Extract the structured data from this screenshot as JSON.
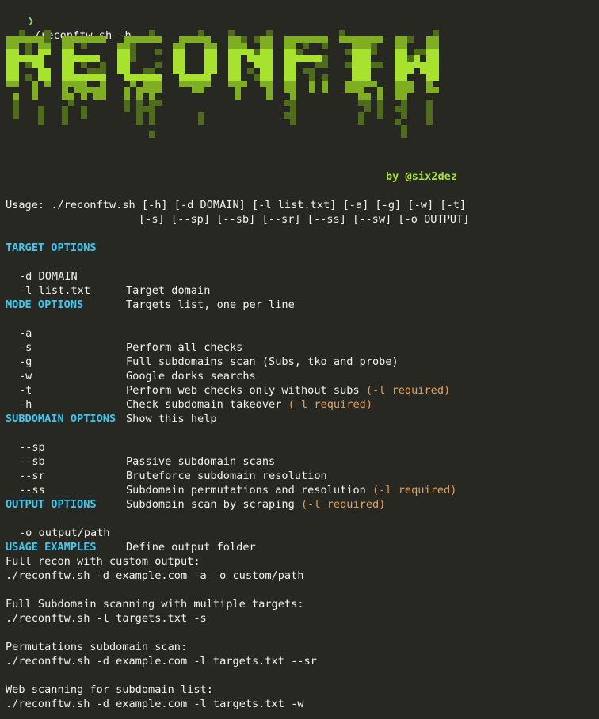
{
  "prompt": {
    "arrow": "❯",
    "command": "./reconftw.sh -h"
  },
  "banner": {
    "logo_text": "RECONFTW",
    "author": "by @six2dez",
    "colors": {
      "bright": "#a6e22e",
      "mid": "#7fae22",
      "dark": "#4f6b1c"
    }
  },
  "usage": {
    "line1": "Usage: ./reconftw.sh [-h] [-d DOMAIN] [-l list.txt] [-a] [-g] [-w] [-t]",
    "line2": "[-s] [--sp] [--sb] [--sr] [--ss] [--sw] [-o OUTPUT]"
  },
  "target_options": {
    "heading": "TARGET OPTIONS",
    "items": [
      {
        "flag": "-d DOMAIN",
        "desc": "Target domain",
        "note": ""
      },
      {
        "flag": "-l list.txt",
        "desc": "Targets list, one per line",
        "note": ""
      }
    ]
  },
  "mode_options": {
    "heading": "MODE OPTIONS",
    "items": [
      {
        "flag": "-a",
        "desc": "Perform all checks",
        "note": ""
      },
      {
        "flag": "-s",
        "desc": "Full subdomains scan (Subs, tko and probe)",
        "note": ""
      },
      {
        "flag": "-g",
        "desc": "Google dorks searchs",
        "note": ""
      },
      {
        "flag": "-w",
        "desc": "Perform web checks only without subs ",
        "note": "(-l required)"
      },
      {
        "flag": "-t",
        "desc": "Check subdomain takeover ",
        "note": "(-l required)"
      },
      {
        "flag": "-h",
        "desc": "Show this help",
        "note": ""
      }
    ]
  },
  "subdomain_options": {
    "heading": "SUBDOMAIN OPTIONS",
    "items": [
      {
        "flag": "--sp",
        "desc": "Passive subdomain scans",
        "note": ""
      },
      {
        "flag": "--sb",
        "desc": "Bruteforce subdomain resolution",
        "note": ""
      },
      {
        "flag": "--sr",
        "desc": "Subdomain permutations and resolution ",
        "note": "(-l required)"
      },
      {
        "flag": "--ss",
        "desc": "Subdomain scan by scraping ",
        "note": "(-l required)"
      }
    ]
  },
  "output_options": {
    "heading": "OUTPUT OPTIONS",
    "items": [
      {
        "flag": "-o output/path",
        "desc": "Define output folder",
        "note": ""
      }
    ]
  },
  "usage_examples": {
    "heading": "USAGE EXAMPLES",
    "items": [
      {
        "title": "Full recon with custom output:",
        "cmd": "./reconftw.sh -d example.com -a -o custom/path"
      },
      {
        "title": "Full Subdomain scanning with multiple targets:",
        "cmd": "./reconftw.sh -l targets.txt -s"
      },
      {
        "title": "Permutations subdomain scan:",
        "cmd": "./reconftw.sh -d example.com -l targets.txt --sr"
      },
      {
        "title": "Web scanning for subdomain list:",
        "cmd": "./reconftw.sh -d example.com -l targets.txt -w"
      }
    ]
  }
}
